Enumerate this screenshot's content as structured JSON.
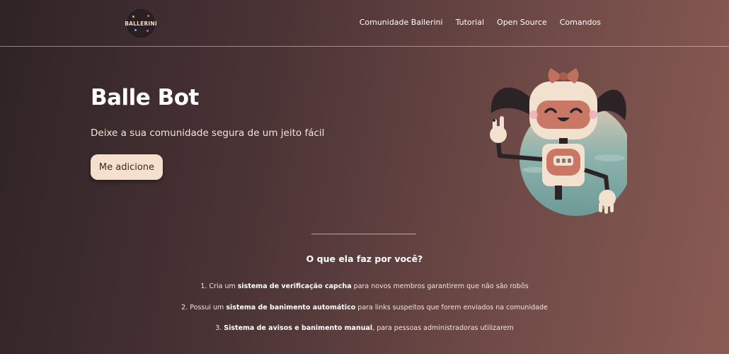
{
  "logo": {
    "text": "BALLERINI",
    "icon": "ballerini-logo"
  },
  "nav": {
    "items": [
      "Comunidade Ballerini",
      "Tutorial",
      "Open Source",
      "Comandos"
    ]
  },
  "hero": {
    "title": "Balle Bot",
    "subtitle": "Deixe a sua comunidade segura de um jeito fácil",
    "cta_label": "Me adicione",
    "illustration": "robot-girl-waving-icon"
  },
  "features_section": {
    "title": "O que ela faz por você?",
    "items": [
      {
        "prefix": "1. Cria um ",
        "bold": "sistema de verificação capcha",
        "suffix": " para novos membros garantirem que não são robôs"
      },
      {
        "prefix": "2. Possui um ",
        "bold": "sistema de banimento automático",
        "suffix": " para links suspeitos que forem enviados na comunidade"
      },
      {
        "prefix": "3. ",
        "bold": "Sistema de avisos e banimento manual",
        "suffix": ", para pessoas administradoras utilizarem"
      }
    ]
  },
  "colors": {
    "accent": "#f6dfcd",
    "bg_start": "#2f2326",
    "bg_end": "#8a5b53",
    "robot_bow": "#c0705c"
  }
}
